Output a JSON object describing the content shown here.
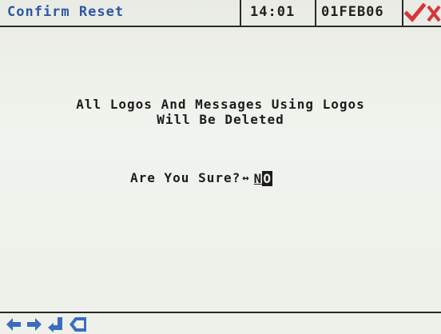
{
  "header": {
    "title": "Confirm Reset",
    "time": "14:01",
    "date": "01FEB06",
    "accept_icon": "check-icon",
    "cancel_icon": "x-icon"
  },
  "main": {
    "message_line1": "All Logos And Messages Using Logos",
    "message_line2": "Will Be Deleted",
    "question": "Are You Sure?",
    "toggle_icon": "left-right-arrow-icon",
    "answer": "NO"
  },
  "footer": {
    "icons": [
      "left-arrow-icon",
      "right-arrow-icon",
      "enter-icon",
      "back-icon"
    ]
  },
  "colors": {
    "title": "#2f57a6",
    "check": "#d8343b",
    "nav_icons": "#3b6cc1",
    "text": "#1c1c1c",
    "background": "#eef1e9"
  }
}
